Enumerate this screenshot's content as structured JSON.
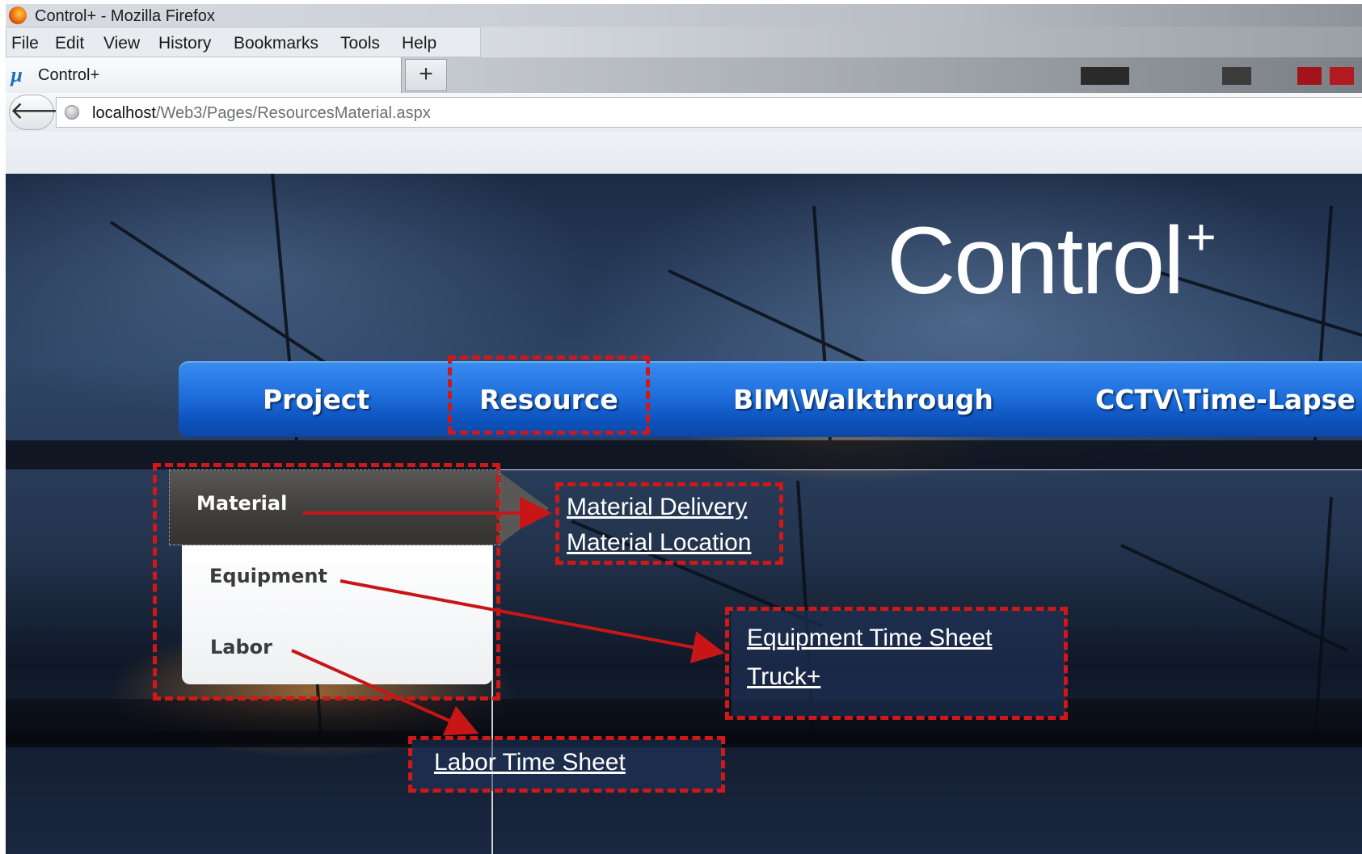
{
  "browser": {
    "window_title": "Control+ - Mozilla Firefox",
    "menu": [
      "File",
      "Edit",
      "View",
      "History",
      "Bookmarks",
      "Tools",
      "Help"
    ],
    "tab_title": "Control+",
    "new_tab_symbol": "+",
    "back_symbol": "🡐",
    "url_host": "localhost",
    "url_path": "/Web3/Pages/ResourcesMaterial.aspx"
  },
  "site": {
    "logo": "Control",
    "logo_plus": "+"
  },
  "nav": {
    "items": [
      "Project",
      "Resource",
      "BIM\\Walkthrough",
      "CCTV\\Time-Lapse"
    ]
  },
  "submenu": {
    "items": [
      "Material",
      "Equipment",
      "Labor"
    ]
  },
  "links": {
    "material": [
      "Material Delivery",
      "Material Location"
    ],
    "equipment": [
      "Equipment Time Sheet",
      "Truck+"
    ],
    "labor": [
      "Labor Time Sheet"
    ]
  },
  "colors": {
    "annotation_red": "#d01818",
    "nav_blue": "#1f6fdc"
  }
}
